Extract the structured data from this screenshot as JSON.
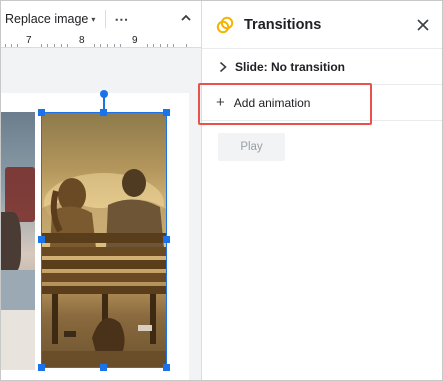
{
  "toolbar": {
    "replace_image_label": "Replace image",
    "replace_image_caret": "▾",
    "more_label": "⋯"
  },
  "ruler": {
    "marks": [
      "7",
      "8",
      "9"
    ]
  },
  "panel": {
    "title": "Transitions",
    "slide_transition_label": "Slide: No transition",
    "add_animation_plus": "+",
    "add_animation_label": "Add animation",
    "play_label": "Play"
  },
  "colors": {
    "selection_blue": "#1a73e8",
    "highlight_red": "#e8524a",
    "transitions_icon_orange": "#f4b400"
  }
}
